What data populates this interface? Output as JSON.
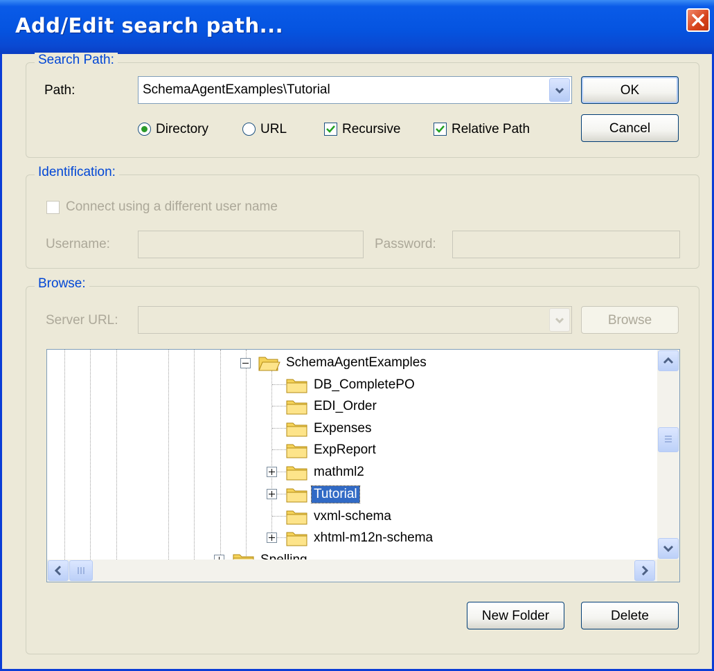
{
  "window": {
    "title": "Add/Edit search path..."
  },
  "search_path": {
    "legend": "Search Path:",
    "path_label": "Path:",
    "path_value": "SchemaAgentExamples\\Tutorial",
    "options": {
      "directory": "Directory",
      "url": "URL",
      "recursive": "Recursive",
      "relative_path": "Relative Path"
    },
    "selected_type": "Directory",
    "recursive_checked": true,
    "relative_checked": true
  },
  "buttons": {
    "ok": "OK",
    "cancel": "Cancel",
    "browse": "Browse",
    "new_folder": "New Folder",
    "delete": "Delete"
  },
  "identification": {
    "legend": "Identification:",
    "connect_label": "Connect using a different user name",
    "username_label": "Username:",
    "password_label": "Password:"
  },
  "browse": {
    "legend": "Browse:",
    "server_url_label": "Server URL:",
    "tree": {
      "parent": "SchemaAgentExamples",
      "children": [
        "DB_CompletePO",
        "EDI_Order",
        "Expenses",
        "ExpReport",
        "mathml2",
        "Tutorial",
        "vxml-schema",
        "xhtml-m12n-schema"
      ],
      "sibling": "Spelling",
      "selected": "Tutorial"
    }
  },
  "colors": {
    "titlebar": "#0554e0",
    "legend": "#0046d5",
    "selection": "#316ac5",
    "dialog_bg": "#ece9d8"
  }
}
